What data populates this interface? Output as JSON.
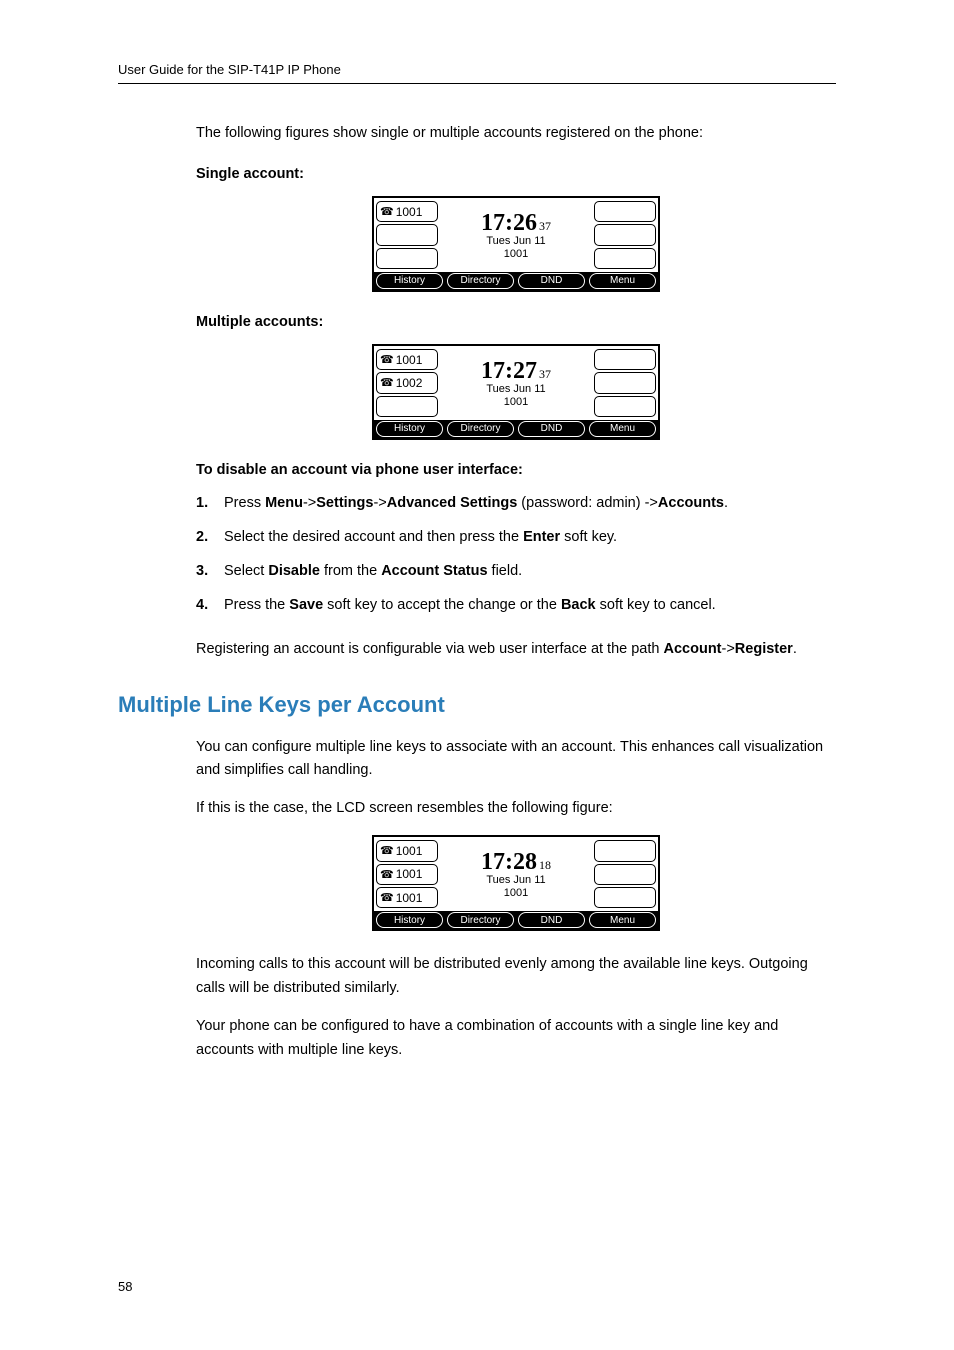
{
  "header": "User Guide for the SIP-T41P IP Phone",
  "page_number": "58",
  "intro_text": "The following figures show single or multiple accounts registered on the phone:",
  "single_label": "Single account:",
  "multiple_label": "Multiple accounts:",
  "disable_heading": "To disable an account via phone user interface:",
  "step1_a": "Press ",
  "step1_b": "Menu",
  "step1_c": "->",
  "step1_d": "Settings",
  "step1_e": "->",
  "step1_f": "Advanced Settings",
  "step1_g": " (password: admin) ->",
  "step1_h": "Accounts",
  "step1_i": ".",
  "step2_a": "Select the desired account and then press the ",
  "step2_b": "Enter",
  "step2_c": " soft key.",
  "step3_a": "Select ",
  "step3_b": "Disable",
  "step3_c": " from the ",
  "step3_d": "Account Status",
  "step3_e": " field.",
  "step4_a": "Press the ",
  "step4_b": "Save",
  "step4_c": " soft key to accept the change or the ",
  "step4_d": "Back",
  "step4_e": " soft key to cancel.",
  "register_a": "Registering an account is configurable via web user interface at the path ",
  "register_b": "Account",
  "register_c": "->",
  "register_d": "Register",
  "register_e": ".",
  "section_heading": "Multiple Line Keys per Account",
  "mlk_p1": "You can configure multiple line keys to associate with an account. This enhances call visualization and simplifies call handling.",
  "mlk_p2": "If this is the case, the LCD screen resembles the following figure:",
  "mlk_p3": "Incoming calls to this account will be distributed evenly among the available line keys. Outgoing calls will be distributed similarly.",
  "mlk_p4": "Your phone can be configured to have a combination of accounts with a single line key and accounts with multiple line keys.",
  "lcd1": {
    "lines_left": [
      "1001",
      "",
      ""
    ],
    "time": "17:26",
    "sec": "37",
    "date": "Tues Jun 11",
    "ext": "1001",
    "softkeys": [
      "History",
      "Directory",
      "DND",
      "Menu"
    ]
  },
  "lcd2": {
    "lines_left": [
      "1001",
      "1002",
      ""
    ],
    "time": "17:27",
    "sec": "37",
    "date": "Tues Jun 11",
    "ext": "1001",
    "softkeys": [
      "History",
      "Directory",
      "DND",
      "Menu"
    ]
  },
  "lcd3": {
    "lines_left": [
      "1001",
      "1001",
      "1001"
    ],
    "time": "17:28",
    "sec": "18",
    "date": "Tues Jun 11",
    "ext": "1001",
    "softkeys": [
      "History",
      "Directory",
      "DND",
      "Menu"
    ]
  },
  "phone_glyph": "☎"
}
